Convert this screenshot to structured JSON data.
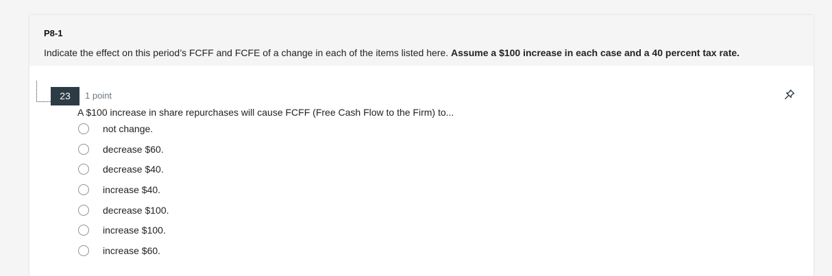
{
  "header": {
    "title": "P8-1",
    "description": "Indicate the effect on this period’s FCFF and FCFE of a change in each of the items listed here.",
    "description_bold": "Assume a $100 increase in each case and a 40 percent tax rate."
  },
  "question": {
    "number": "23",
    "points": "1 point",
    "text": "A $100 increase in share repurchases will cause FCFF (Free Cash Flow to the Firm) to...",
    "answers": [
      {
        "label": "not change."
      },
      {
        "label": "decrease $60."
      },
      {
        "label": "decrease $40."
      },
      {
        "label": "increase $40."
      },
      {
        "label": "decrease $100."
      },
      {
        "label": "increase $100."
      },
      {
        "label": "increase $60."
      }
    ]
  },
  "icons": {
    "pin": "pin-icon"
  },
  "colors": {
    "question_number_bg": "#2d3b45",
    "page_bg": "#f5f5f5",
    "card_bg": "#ffffff"
  }
}
